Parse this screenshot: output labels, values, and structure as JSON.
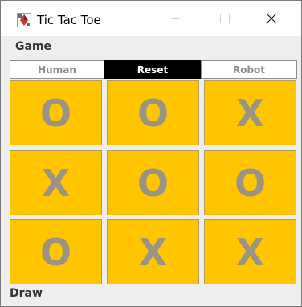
{
  "window": {
    "title": "Tic Tac Toe",
    "app_icon": "tic-tac-toe-app-icon"
  },
  "menubar": {
    "items": [
      {
        "label_mnemonic": "G",
        "label_rest": "ame"
      }
    ]
  },
  "toolbar": {
    "human_label": "Human",
    "reset_label": "Reset",
    "robot_label": "Robot"
  },
  "board": {
    "cells": [
      "O",
      "O",
      "X",
      "X",
      "O",
      "O",
      "O",
      "X",
      "X"
    ],
    "cell_color": "#ffc600",
    "mark_color": "#9b9485"
  },
  "status": {
    "text": "Draw"
  }
}
